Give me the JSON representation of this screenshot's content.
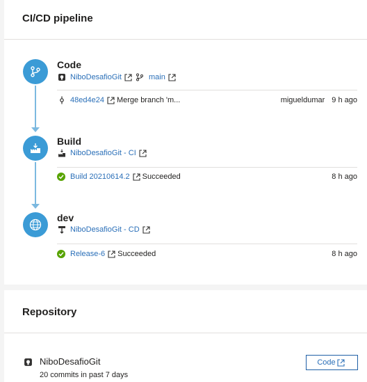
{
  "pipeline": {
    "title": "CI/CD pipeline",
    "stages": [
      {
        "name": "Code",
        "repo_link": "NiboDesafioGit",
        "branch": "main",
        "row": {
          "id": "48ed4e24",
          "message": "Merge branch 'm...",
          "author": "migueldumar",
          "time": "9 h ago"
        }
      },
      {
        "name": "Build",
        "pipeline_link": "NiboDesafioGit - CI",
        "row": {
          "id": "Build 20210614.2",
          "status": "Succeeded",
          "time": "8 h ago"
        }
      },
      {
        "name": "dev",
        "pipeline_link": "NiboDesafioGit - CD",
        "row": {
          "id": "Release-6",
          "status": "Succeeded",
          "time": "8 h ago"
        }
      }
    ]
  },
  "repository": {
    "title": "Repository",
    "name": "NiboDesafioGit",
    "commits": "20 commits in past 7 days",
    "code_button": "Code"
  },
  "colors": {
    "accent": "#3b9bd6",
    "link": "#2a6fb8",
    "success": "#57a300"
  },
  "icons": [
    "repo-icon",
    "branch-icon",
    "commit-icon",
    "build-icon",
    "release-icon",
    "external-link-icon",
    "success-icon",
    "globe-icon"
  ]
}
